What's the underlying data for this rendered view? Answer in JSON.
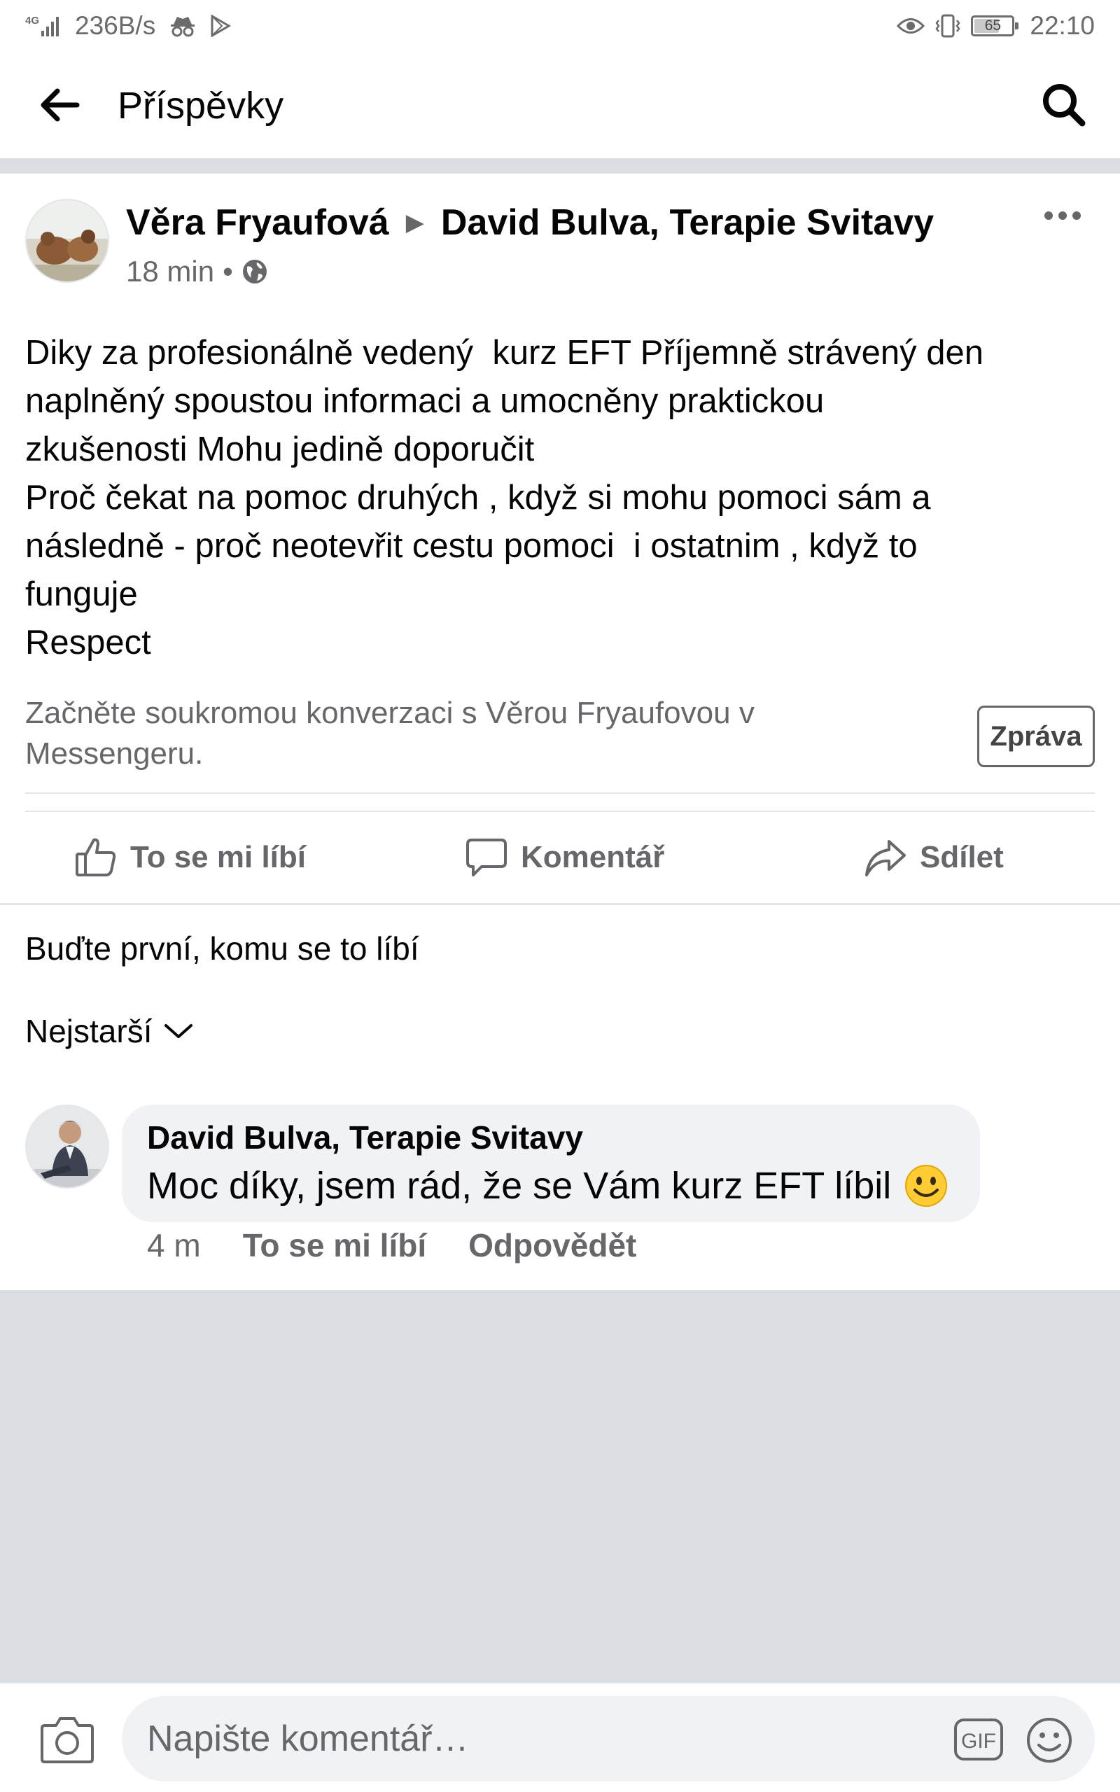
{
  "status_bar": {
    "network": "4G",
    "speed": "236B/s",
    "battery": "65",
    "time": "22:10"
  },
  "header": {
    "title": "Příspěvky"
  },
  "post": {
    "author": "Věra Fryaufová",
    "target": "David Bulva, Terapie Svitavy",
    "time": "18 min",
    "separator": "•",
    "text_lines": [
      "Diky za profesionálně vedený  kurz EFT Příjemně strávený den",
      "naplněný spoustou informaci a umocněny praktickou",
      "zkušenosti Mohu jedině doporučit",
      "Proč čekat na pomoc druhých , když si mohu pomoci sám a",
      "následně - proč neotevřit cestu pomoci  i ostatnim , když to",
      "funguje",
      "Respect"
    ],
    "messenger_prompt": "Začněte soukromou konverzaci s Věrou Fryaufovou v Messengeru.",
    "message_button": "Zpráva"
  },
  "actions": {
    "like": "To se mi líbí",
    "comment": "Komentář",
    "share": "Sdílet"
  },
  "reactions_summary": "Buďte první, komu se to líbí",
  "sort_label": "Nejstarší",
  "comment": {
    "author": "David Bulva, Terapie Svitavy",
    "text": "Moc díky, jsem rád, že se Vám kurz EFT líbil",
    "time": "4 m",
    "like": "To se mi líbí",
    "reply": "Odpovědět"
  },
  "composer": {
    "placeholder": "Napište komentář…",
    "gif_label": "GIF"
  },
  "colors": {
    "text": "#050505",
    "secondary": "#65676b",
    "bubble": "#f0f2f5",
    "separator": "#dadde1"
  }
}
